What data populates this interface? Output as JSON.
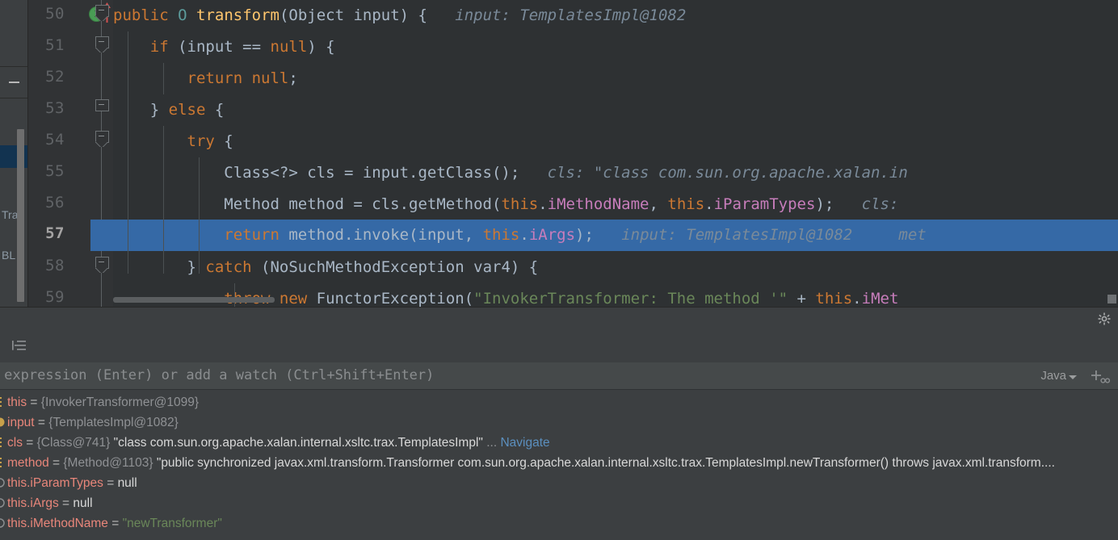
{
  "editor": {
    "lines": [
      {
        "number": "50",
        "has_run_icon": true,
        "run_icon": "run-method-icon",
        "code": "public O transform(Object input) {",
        "hint": "input: TemplatesImpl@1082"
      },
      {
        "number": "51",
        "code": "if (input == null) {",
        "hint": ""
      },
      {
        "number": "52",
        "code": "return null;",
        "hint": ""
      },
      {
        "number": "53",
        "code": "} else {",
        "hint": ""
      },
      {
        "number": "54",
        "code": "try {",
        "hint": ""
      },
      {
        "number": "55",
        "code": "Class<?> cls = input.getClass();",
        "hint": "cls: \"class com.sun.org.apache.xalan.in"
      },
      {
        "number": "56",
        "code": "Method method = cls.getMethod(this.iMethodName, this.iParamTypes);",
        "hint": "cls:"
      },
      {
        "number": "57",
        "current": true,
        "code": "return method.invoke(input, this.iArgs);",
        "hint": "input: TemplatesImpl@1082     met"
      },
      {
        "number": "58",
        "code": "} catch (NoSuchMethodException var4) {",
        "hint": ""
      },
      {
        "number": "59",
        "code": "throw new FunctorException(\"InvokerTransformer: The method '\" + this.iMet",
        "hint": ""
      }
    ]
  },
  "left_panel": {
    "fragment_texts": [
      "Tran",
      "BL"
    ]
  },
  "debugger": {
    "header": {
      "settings_icon": "gear-icon"
    },
    "toolbar": {
      "layout_icon": "watches-layout-icon"
    },
    "expression": {
      "value": "",
      "placeholder": "uate expression (Enter) or add a watch (Ctrl+Shift+Enter)",
      "language": "Java",
      "add_watch_icon": "add-watch-icon"
    },
    "variables": [
      {
        "icon": "field-icon",
        "name": "this",
        "eq": " = ",
        "ref": "{InvokerTransformer@1099}",
        "value": "",
        "value_kind": "none",
        "link": ""
      },
      {
        "icon": "parameter-icon",
        "name": "input",
        "eq": " = ",
        "ref": "{TemplatesImpl@1082}",
        "value": "",
        "value_kind": "none",
        "link": ""
      },
      {
        "icon": "field-icon",
        "name": "cls",
        "eq": " = ",
        "ref": "{Class@741}",
        "value": "\"class com.sun.org.apache.xalan.internal.xsltc.trax.TemplatesImpl\"",
        "value_kind": "text",
        "ellipsis": "...",
        "link": "Navigate"
      },
      {
        "icon": "field-icon",
        "name": "method",
        "eq": " = ",
        "ref": "{Method@1103}",
        "value": "\"public synchronized javax.xml.transform.Transformer com.sun.org.apache.xalan.internal.xsltc.trax.TemplatesImpl.newTransformer() throws javax.xml.transform....",
        "value_kind": "text",
        "ellipsis": "",
        "link": ""
      },
      {
        "icon": "watch-icon",
        "name": "this.iParamTypes",
        "eq": " = ",
        "ref": "",
        "value": "null",
        "value_kind": "null",
        "link": ""
      },
      {
        "icon": "watch-icon",
        "name": "this.iArgs",
        "eq": " = ",
        "ref": "",
        "value": "null",
        "value_kind": "null",
        "link": ""
      },
      {
        "icon": "watch-icon",
        "name": "this.iMethodName",
        "eq": " = ",
        "ref": "",
        "value": "\"newTransformer\"",
        "value_kind": "string",
        "link": ""
      }
    ]
  },
  "colors": {
    "editor_bg": "#2e3133",
    "gutter_bg": "#313335",
    "selection": "#3569a6",
    "panel_bg": "#3c3f41",
    "keyword": "#cc7832",
    "string": "#6a8759",
    "field": "#c77dbb",
    "method": "#ffc66d",
    "identifier": "#a9b7c6",
    "hint": "#7a8a99",
    "var_name": "#e8867a",
    "link": "#5b8fbe"
  }
}
